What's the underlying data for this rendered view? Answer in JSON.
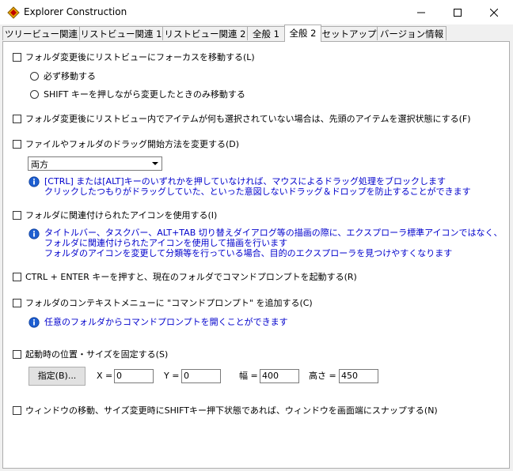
{
  "window": {
    "title": "Explorer Construction",
    "icon": "app-diamond-icon"
  },
  "tabs": [
    {
      "label": "ツリービュー関連",
      "active": false
    },
    {
      "label": "リストビュー関連 1",
      "active": false
    },
    {
      "label": "リストビュー関連 2",
      "active": false
    },
    {
      "label": "全般 1",
      "active": false
    },
    {
      "label": "全般 2",
      "active": true
    },
    {
      "label": "セットアップ",
      "active": false
    },
    {
      "label": "バージョン情報",
      "active": false
    }
  ],
  "options": {
    "focus_list": {
      "label": "フォルダ変更後にリストビューにフォーカスを移動する(L)",
      "checked": false
    },
    "radio_always": {
      "label": "必ず移動する",
      "selected": false
    },
    "radio_shift": {
      "label": "SHIFT キーを押しながら変更したときのみ移動する",
      "selected": false
    },
    "select_first": {
      "label": "フォルダ変更後にリストビュー内でアイテムが何も選択されていない場合は、先頭のアイテムを選択状態にする(F)",
      "checked": false
    },
    "drag_method": {
      "label": "ファイルやフォルダのドラッグ開始方法を変更する(D)",
      "checked": false,
      "select_value": "両方"
    },
    "drag_info": [
      "[CTRL] または[ALT]キーのいずれかを押していなければ、マウスによるドラッグ処理をブロックします",
      "クリックしたつもりがドラッグしていた、といった意図しないドラッグ＆ドロップを防止することができます"
    ],
    "assoc_icon": {
      "label": "フォルダに関連付けられたアイコンを使用する(I)",
      "checked": false
    },
    "assoc_info": [
      "タイトルバー、タスクバー、ALT+TAB 切り替えダイアログ等の描画の際に、エクスプローラ標準アイコンではなく、",
      "フォルダに関連付けられたアイコンを使用して描画を行います",
      "フォルダのアイコンを変更して分類等を行っている場合、目的のエクスプローラを見つけやすくなります"
    ],
    "ctrl_enter": {
      "label": "CTRL + ENTER キーを押すと、現在のフォルダでコマンドプロンプトを起動する(R)",
      "checked": false
    },
    "context_menu": {
      "label": "フォルダのコンテキストメニューに \"コマンドプロンプト\" を追加する(C)",
      "checked": false
    },
    "context_info": "任意のフォルダからコマンドプロンプトを開くことができます",
    "fix_pos": {
      "label": "起動時の位置・サイズを固定する(S)",
      "checked": false
    },
    "pos_fields": {
      "button": "指定(B)...",
      "x_label": "X =",
      "x_value": "0",
      "y_label": "Y =",
      "y_value": "0",
      "w_label": "幅 =",
      "w_value": "400",
      "h_label": "高さ =",
      "h_value": "450"
    },
    "snap": {
      "label": "ウィンドウの移動、サイズ変更時にSHIFTキー押下状態であれば、ウィンドウを画面端にスナップする(N)",
      "checked": false
    }
  }
}
